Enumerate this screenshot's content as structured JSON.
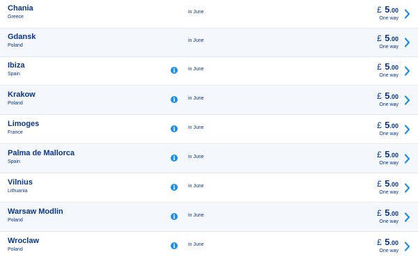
{
  "colors": {
    "text": "#073590",
    "accent": "#1f8ee6",
    "alt_row": "#f4f7fb",
    "divider": "#dfe6ee"
  },
  "icons": {
    "info": "info-icon",
    "chevron": "chevron-right-icon"
  },
  "info_glyph": "i",
  "destinations": [
    {
      "city": "Chania",
      "country": "Greece",
      "has_info": false,
      "date": "in June",
      "currency": "£",
      "price_whole": "5",
      "price_cents": ".00",
      "trip": "One way"
    },
    {
      "city": "Gdansk",
      "country": "Poland",
      "has_info": false,
      "date": "in June",
      "currency": "£",
      "price_whole": "5",
      "price_cents": ".00",
      "trip": "One way"
    },
    {
      "city": "Ibiza",
      "country": "Spain",
      "has_info": true,
      "date": "in June",
      "currency": "£",
      "price_whole": "5",
      "price_cents": ".00",
      "trip": "One way"
    },
    {
      "city": "Krakow",
      "country": "Poland",
      "has_info": true,
      "date": "in June",
      "currency": "£",
      "price_whole": "5",
      "price_cents": ".00",
      "trip": "One way"
    },
    {
      "city": "Limoges",
      "country": "France",
      "has_info": true,
      "date": "in June",
      "currency": "£",
      "price_whole": "5",
      "price_cents": ".00",
      "trip": "One way"
    },
    {
      "city": "Palma de Mallorca",
      "country": "Spain",
      "has_info": true,
      "date": "in June",
      "currency": "£",
      "price_whole": "5",
      "price_cents": ".00",
      "trip": "One way"
    },
    {
      "city": "Vilnius",
      "country": "Lithuania",
      "has_info": true,
      "date": "in June",
      "currency": "£",
      "price_whole": "5",
      "price_cents": ".00",
      "trip": "One way"
    },
    {
      "city": "Warsaw Modlin",
      "country": "Poland",
      "has_info": true,
      "date": "in June",
      "currency": "£",
      "price_whole": "5",
      "price_cents": ".00",
      "trip": "One way"
    },
    {
      "city": "Wroclaw",
      "country": "Poland",
      "has_info": true,
      "date": "in June",
      "currency": "£",
      "price_whole": "5",
      "price_cents": ".00",
      "trip": "One way"
    }
  ]
}
